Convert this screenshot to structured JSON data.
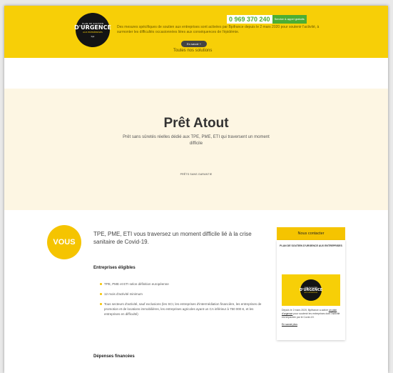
{
  "banner": {
    "logo_line1": "PLAN DE SOUTIEN",
    "logo_line2": "D'URGENCE",
    "logo_line3": "AUX ENTREPRISES",
    "logo_line4": "bpi",
    "text": "Des mesures spécifiques de soutien aux entreprises sont activées par Bpifrance depuis le 2 mars 2020 pour soutenir l'activité, à surmonter les difficultés occasionnées liées aux conséquences de l'épidémie.",
    "phone_number": "0 969 370 240",
    "phone_tag": "Service & appel gratuits",
    "learn_more": "En savoir +",
    "all_solutions": "Toutes nos solutions"
  },
  "hero": {
    "title": "Prêt Atout",
    "subtitle": "Prêt sans sûretés réelles dédié aux TPE, PME, ETI qui traversent un moment difficile",
    "crumb": "PRÊTS SANS GARANTIE"
  },
  "content": {
    "badge": "VOUS",
    "intro": "TPE, PME, ETI vous traversez un moment difficile lié à la crise sanitaire de Covid-19.",
    "eligible_heading": "Entreprises éligibles",
    "eligible_items": [
      "TPE, PME et ETI selon définition européenne",
      "12 mois d'activité minimum",
      "Tous secteurs d'activité, sauf exclusions (les SCI, les entreprises d'intermédiation financière, les entreprises de promotion et de locations immobilières, les entreprises agricoles ayant un CA inférieur à 750 000 €, et les entreprises en difficulté)"
    ],
    "depenses_heading": "Dépenses financées"
  },
  "sidebar": {
    "contact_label": "Nous contacter",
    "card_title": "PLAN DE SOUTIEN D'URGENCE AUX ENTREPRISES",
    "logo_line1": "PLAN DE SOUTIEN",
    "logo_line2": "D'URGENCE",
    "logo_line3": "AUX ENTREPRISES",
    "text_before_link": "Depuis le 2 mars 2020, Bpifrance a activé ",
    "text_link": "un plan d'urgence",
    "text_after_link": " pour soutenir les entreprises dont l'activité est impactée par le Covid-19.",
    "learn_more": "En savoir plus"
  },
  "colors": {
    "brand_yellow": "#f7cf07",
    "accent_yellow": "#f5c400",
    "hero_bg": "#fdf6e3",
    "phone_green": "#4cae34"
  }
}
